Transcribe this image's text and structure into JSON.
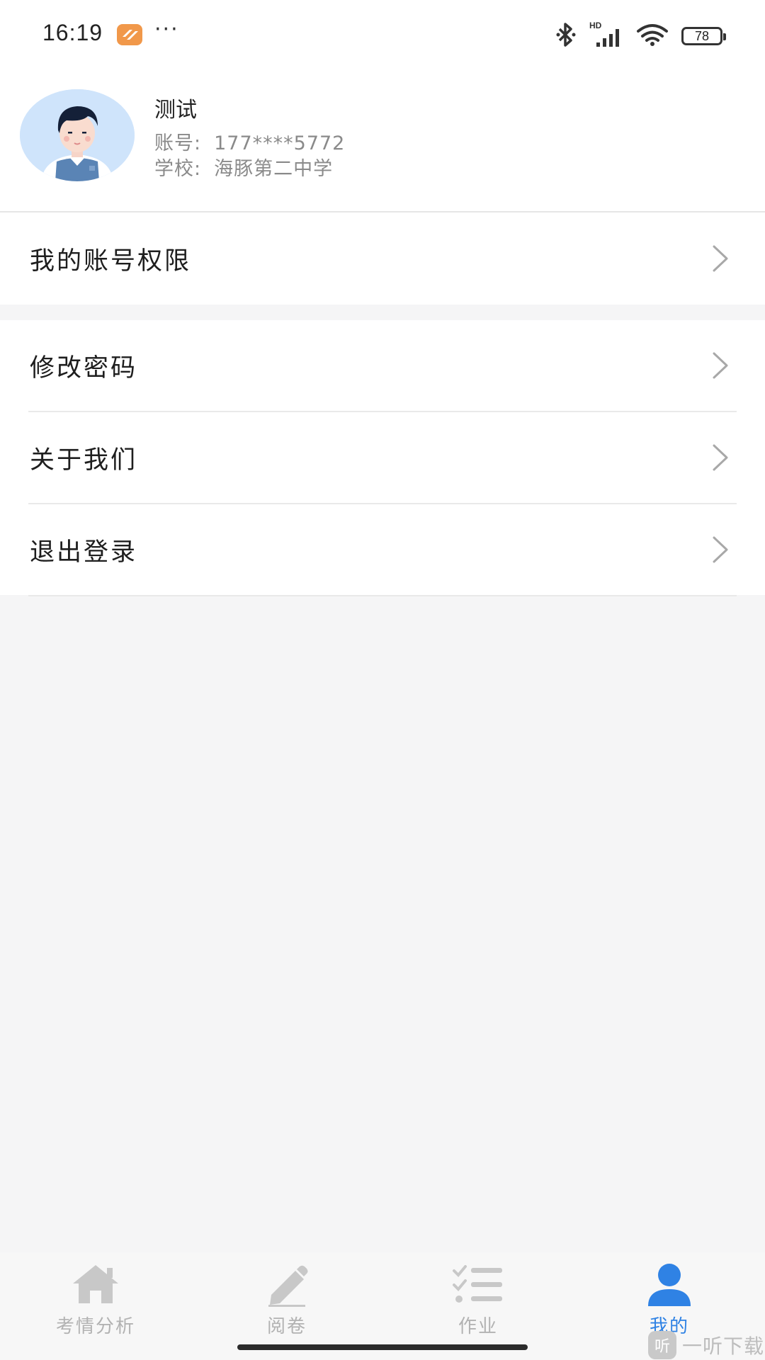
{
  "status_bar": {
    "time": "16:19",
    "more": "···",
    "network_label": "HD",
    "battery": "78",
    "icons": [
      "app-notification-icon",
      "bluetooth-icon",
      "signal-icon",
      "wifi-icon",
      "battery-icon"
    ]
  },
  "profile": {
    "name": "测试",
    "account_label": "账号:",
    "account_value": "177****5772",
    "school_label": "学校:",
    "school_value": "海豚第二中学"
  },
  "menu": {
    "group1": [
      {
        "label": "我的账号权限"
      }
    ],
    "group2": [
      {
        "label": "修改密码"
      },
      {
        "label": "关于我们"
      },
      {
        "label": "退出登录"
      }
    ]
  },
  "tabs": [
    {
      "label": "考情分析",
      "icon": "home-icon",
      "active": false
    },
    {
      "label": "阅卷",
      "icon": "pencil-icon",
      "active": false
    },
    {
      "label": "作业",
      "icon": "checklist-icon",
      "active": false
    },
    {
      "label": "我的",
      "icon": "user-icon",
      "active": true
    }
  ],
  "colors": {
    "accent": "#2f82e4",
    "inactive_tab": "#b2b2b2",
    "background": "#f5f5f6"
  },
  "watermark": {
    "logo_char": "听",
    "text": "一听下载"
  }
}
